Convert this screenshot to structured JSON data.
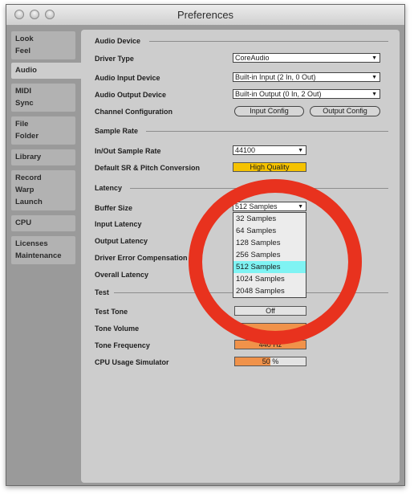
{
  "window": {
    "title": "Preferences"
  },
  "sidebar": {
    "items": [
      {
        "lines": [
          "Look",
          "Feel"
        ]
      },
      {
        "lines": [
          "Audio"
        ]
      },
      {
        "lines": [
          "MIDI",
          "Sync"
        ]
      },
      {
        "lines": [
          "File",
          "Folder"
        ]
      },
      {
        "lines": [
          "Library"
        ]
      },
      {
        "lines": [
          "Record",
          "Warp",
          "Launch"
        ]
      },
      {
        "lines": [
          "CPU"
        ]
      },
      {
        "lines": [
          "Licenses",
          "Maintenance"
        ]
      }
    ]
  },
  "audio_device": {
    "section": "Audio Device",
    "driver_type": {
      "label": "Driver Type",
      "value": "CoreAudio"
    },
    "input_device": {
      "label": "Audio Input Device",
      "value": "Built-in Input (2 In, 0 Out)"
    },
    "output_device": {
      "label": "Audio Output Device",
      "value": "Built-in Output (0 In, 2 Out)"
    },
    "channel_config": {
      "label": "Channel Configuration",
      "input_button": "Input Config",
      "output_button": "Output Config"
    }
  },
  "sample_rate": {
    "section": "Sample Rate",
    "io_rate": {
      "label": "In/Out Sample Rate",
      "value": "44100"
    },
    "default_sr": {
      "label": "Default SR & Pitch Conversion",
      "value": "High Quality"
    }
  },
  "latency": {
    "section": "Latency",
    "buffer_size": {
      "label": "Buffer Size",
      "value": "512 Samples"
    },
    "input_latency": {
      "label": "Input Latency"
    },
    "output_latency": {
      "label": "Output Latency"
    },
    "driver_error": {
      "label": "Driver Error Compensation"
    },
    "overall_latency": {
      "label": "Overall Latency"
    }
  },
  "buffer_dropdown": {
    "options": [
      "32 Samples",
      "64 Samples",
      "128 Samples",
      "256 Samples",
      "512 Samples",
      "1024 Samples",
      "2048 Samples"
    ],
    "selected": "512 Samples"
  },
  "test": {
    "section": "Test",
    "tone": {
      "label": "Test Tone",
      "value": "Off"
    },
    "volume": {
      "label": "Tone Volume"
    },
    "frequency": {
      "label": "Tone Frequency",
      "value": "440 Hz"
    },
    "cpu_sim": {
      "label": "CPU Usage Simulator",
      "value": "50 %",
      "fraction": 0.5
    }
  },
  "colors": {
    "accent_orange": "#f0924a",
    "highlight_cyan": "#7ff3f3",
    "annotation_red": "#e8321e"
  }
}
